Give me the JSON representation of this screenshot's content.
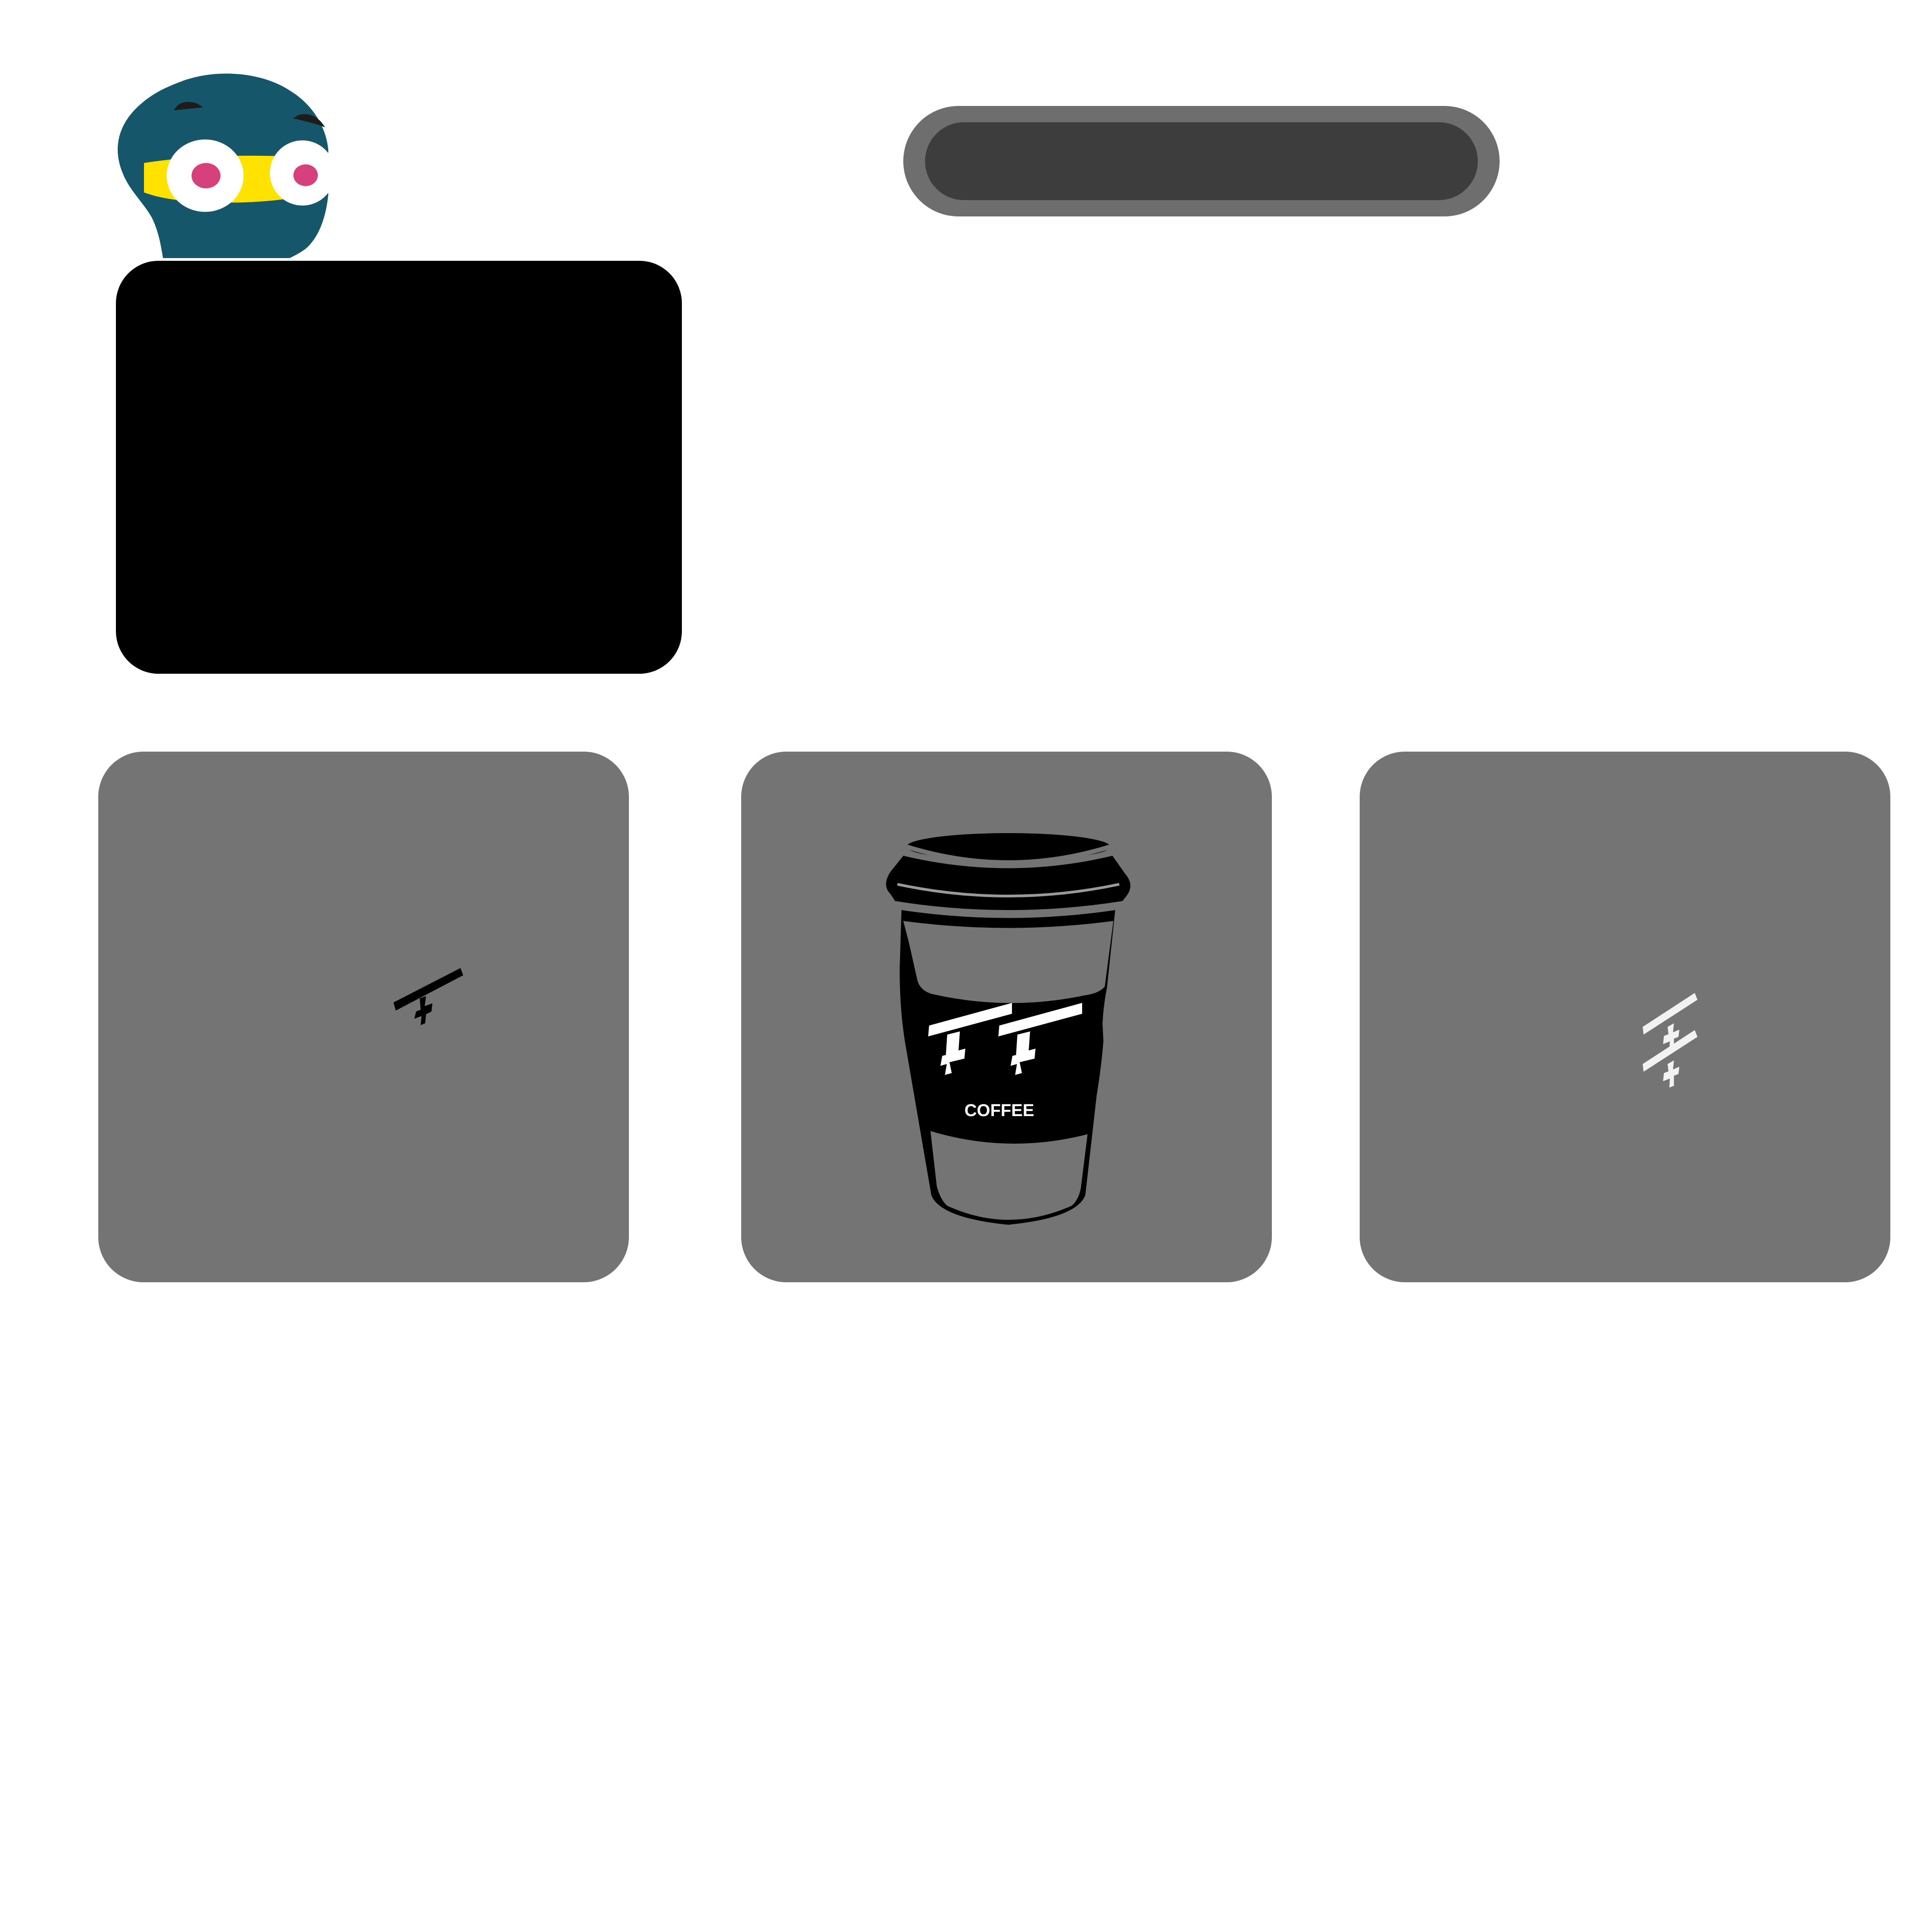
{
  "search": {
    "value": "",
    "placeholder": ""
  },
  "tiles": [
    {
      "icon": "tt-logo-tilted-icon"
    },
    {
      "icon": "coffee-cup-icon",
      "caption": "COFFEE"
    },
    {
      "icon": "tt-logo-stacked-icon"
    }
  ],
  "colors": {
    "mascot_body": "#15566a",
    "mascot_band": "#ffe200",
    "mascot_pupil": "#d6407c",
    "panel": "#000000",
    "search_outer": "#6e6e6e",
    "search_inner": "#3d3d3d",
    "tile": "#747474"
  }
}
